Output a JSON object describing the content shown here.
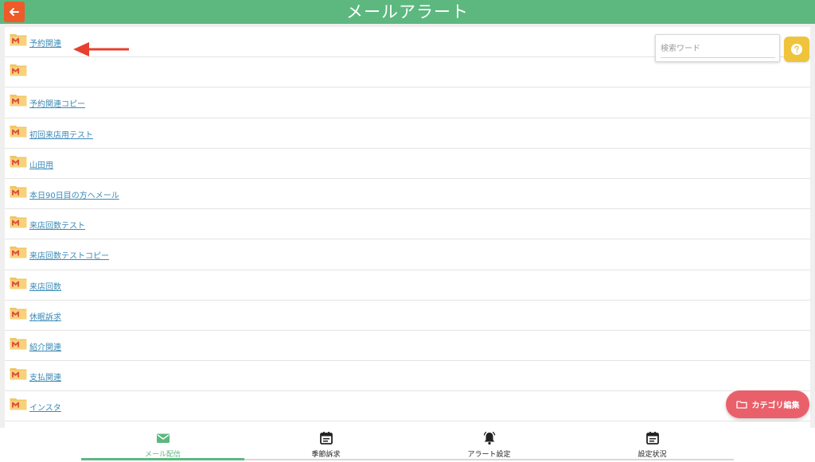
{
  "header": {
    "title": "メールアラート",
    "back_icon": "arrow-left-icon",
    "color": "#5cb87f",
    "back_color": "#ef5a2a"
  },
  "search": {
    "placeholder": "検索ワード",
    "value": ""
  },
  "help": {
    "icon": "question-icon",
    "color": "#f0c43a"
  },
  "list": {
    "folder_icon": "mail-folder-icon",
    "items": [
      {
        "label": "予約関連"
      },
      {
        "label": ""
      },
      {
        "label": "予約関連コピー"
      },
      {
        "label": "初回来店用テスト"
      },
      {
        "label": "山田用"
      },
      {
        "label": "本日90日目の方へメール"
      },
      {
        "label": "来店回数テスト"
      },
      {
        "label": "来店回数テストコピー"
      },
      {
        "label": "来店回数"
      },
      {
        "label": "休眠訴求"
      },
      {
        "label": "紹介関連"
      },
      {
        "label": "支払関連"
      },
      {
        "label": "インスタ"
      }
    ]
  },
  "category_edit": {
    "label": "カテゴリ編集",
    "icon": "folder-icon",
    "color": "#e9606b"
  },
  "bottom_nav": {
    "tabs": [
      {
        "label": "メール配信",
        "icon": "mail-icon",
        "active": true
      },
      {
        "label": "季節訴求",
        "icon": "calendar-icon",
        "active": false
      },
      {
        "label": "アラート設定",
        "icon": "bell-icon",
        "active": false
      },
      {
        "label": "設定状況",
        "icon": "calendar-check-icon",
        "active": false
      }
    ]
  },
  "annotation": {
    "icon": "red-arrow-icon",
    "color": "#e8402f"
  }
}
